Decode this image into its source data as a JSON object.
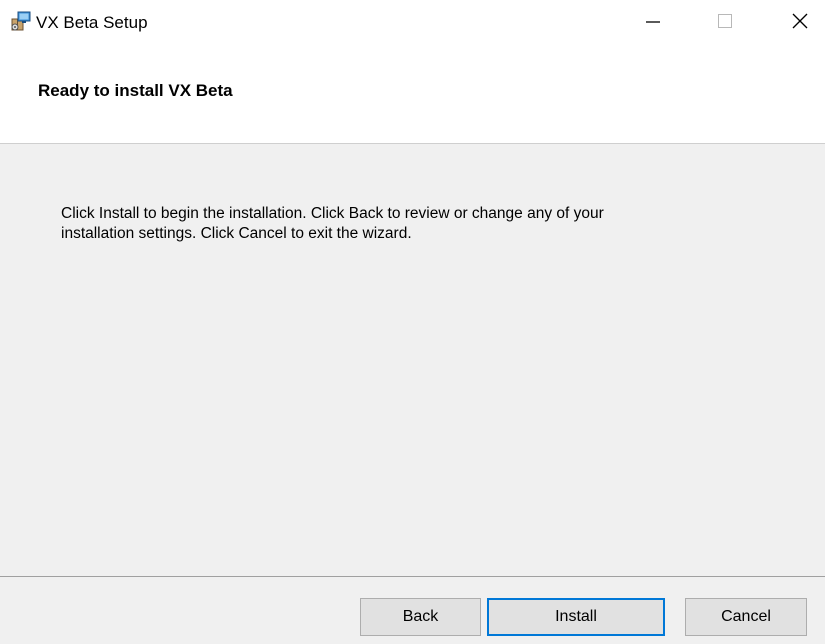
{
  "window": {
    "title": "VX Beta Setup",
    "icon": "installer-package-icon",
    "controls": [
      "minimize-icon",
      "maximize-icon",
      "close-icon"
    ]
  },
  "header": {
    "title": "Ready to install VX Beta"
  },
  "content": {
    "line1": "Click Install to begin the installation. Click Back to review or change any of your",
    "line2": "installation settings. Click Cancel to exit the wizard."
  },
  "buttons": {
    "back": "Back",
    "install": "Install",
    "cancel": "Cancel"
  },
  "colors": {
    "accent": "#0078d7",
    "panel": "#f0f0f0",
    "button": "#e1e1e1"
  }
}
